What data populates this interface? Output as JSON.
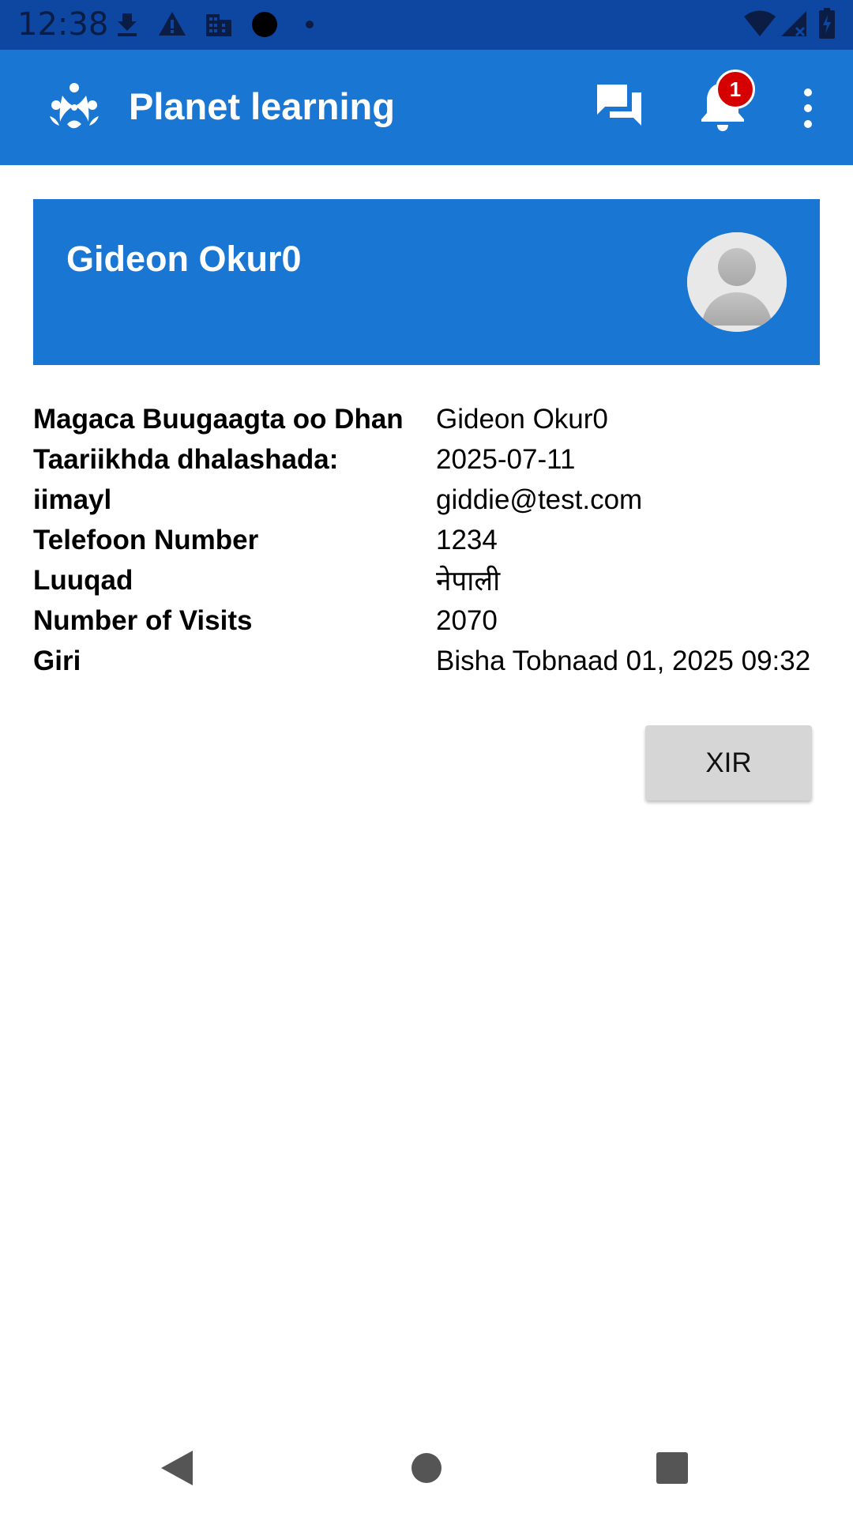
{
  "status_bar": {
    "time": "12:38",
    "icons": [
      "download-icon",
      "warning-icon",
      "building-icon",
      "record-dot-icon",
      "small-dot-icon",
      "wifi-icon",
      "signal-icon",
      "battery-icon"
    ]
  },
  "app_bar": {
    "title": "Planet learning",
    "logo": "planet-learning-logo",
    "notification_count": "1",
    "icons": [
      "chat-icon",
      "bell-icon",
      "more-vert-icon"
    ],
    "color": "#1976d2"
  },
  "profile": {
    "name": "Gideon Okur0",
    "avatar": "avatar-placeholder-icon"
  },
  "details": [
    {
      "label": "Magaca Buugaagta oo Dhan",
      "value": "Gideon Okur0"
    },
    {
      "label": "Taariikhda dhalashada:",
      "value": "2025-07-11"
    },
    {
      "label": "iimayl",
      "value": "giddie@test.com"
    },
    {
      "label": "Telefoon Number",
      "value": "1234"
    },
    {
      "label": "Luuqad",
      "value": "नेपाली"
    },
    {
      "label": "Number of Visits",
      "value": "2070"
    },
    {
      "label": "Giri",
      "value": "Bisha Tobnaad 01, 2025 09:32"
    }
  ],
  "close_button": {
    "label": "XIR"
  },
  "nav_bar": {
    "icons": [
      "back-icon",
      "home-icon",
      "recents-icon"
    ]
  }
}
